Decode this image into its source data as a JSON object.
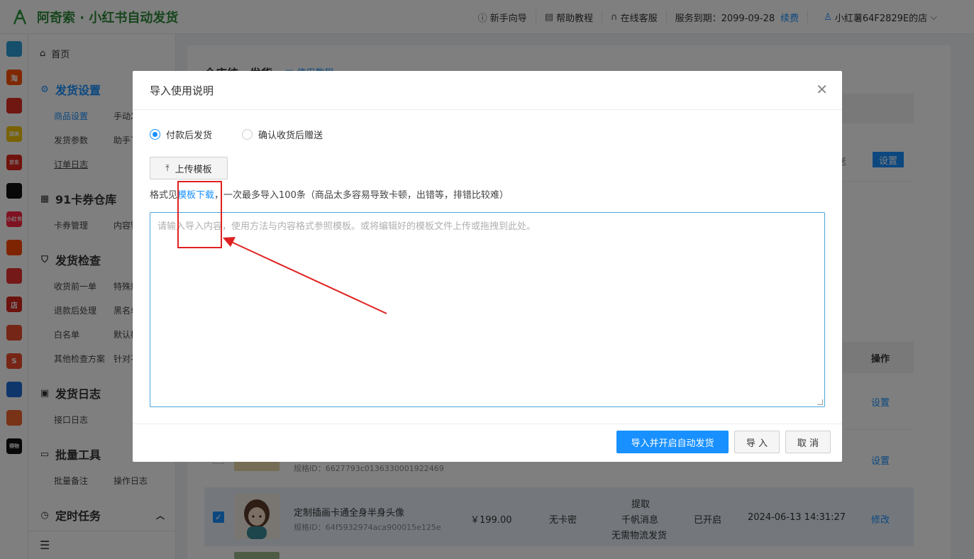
{
  "header": {
    "app_title": "阿奇索 · 小红书自动发货",
    "guide": "新手向导",
    "help": "帮助教程",
    "service": "在线客服",
    "expire": "服务到期：2099-09-28",
    "renew": "续费",
    "user": "小红薯64F2829E的店"
  },
  "strip": [
    {
      "icon": "grid-icon",
      "color": "#2a9fd6",
      "label": ""
    },
    {
      "icon": "taobao-icon",
      "color": "#ff5000",
      "label": "淘"
    },
    {
      "icon": "pinduoduo-icon",
      "color": "#e02e24",
      "label": ""
    },
    {
      "icon": "guomei-icon",
      "color": "#f5c400",
      "label": "国美"
    },
    {
      "icon": "jd-icon",
      "color": "#e1251b",
      "label": "京东"
    },
    {
      "icon": "douyin-icon",
      "color": "#111111",
      "label": ""
    },
    {
      "icon": "xiaohongshu-icon",
      "color": "#ff2442",
      "label": "小红书"
    },
    {
      "icon": "kuaishou-icon",
      "color": "#ff4906",
      "label": ""
    },
    {
      "icon": "thumb-icon",
      "color": "#e8322e",
      "label": ""
    },
    {
      "icon": "shop-icon",
      "color": "#d9261c",
      "label": "店"
    },
    {
      "icon": "bag-icon",
      "color": "#ea4d2c",
      "label": ""
    },
    {
      "icon": "shopee-icon",
      "color": "#ee4d2d",
      "label": "S"
    },
    {
      "icon": "link-icon",
      "color": "#1c6cd6",
      "label": ""
    },
    {
      "icon": "gift-icon",
      "color": "#f0642a",
      "label": ""
    },
    {
      "icon": "dewu-icon",
      "color": "#111111",
      "label": "得物"
    }
  ],
  "sidebar": {
    "home": "首页",
    "ship_settings": "发货设置",
    "goods_settings": "商品设置",
    "manual_ship": "手动发",
    "ship_params": "发货参数",
    "assistant": "助手下",
    "order_log": "订单日志",
    "card_store": "91卡券仓库",
    "card_manage": "卡券管理",
    "content": "内容管",
    "ship_check": "发货检查",
    "before_receipt": "收货前一单",
    "special": "特殊规",
    "after_refund": "退款后处理",
    "blacklist": "黑名单",
    "whitelist": "白名单",
    "default_rule": "默认检",
    "other_check": "其他检查方案",
    "target": "针对不",
    "ship_log": "发货日志",
    "api_log": "接口日志",
    "batch_tools": "批量工具",
    "batch_note": "批量备注",
    "op_log": "操作日志",
    "timed_task": "定时任务"
  },
  "main": {
    "title": "全店统一发货",
    "help_link": "使用教程",
    "partial_text": "送",
    "setting_btn": "设置",
    "col_op": "操作",
    "rows": [
      {
        "name": "",
        "spec": "",
        "price": "",
        "card": "",
        "extra": [],
        "status": "",
        "time": "",
        "action": "设置",
        "checked": false
      },
      {
        "name": "",
        "spec": "规格ID：6627793c0136330001922469",
        "price": "",
        "card": "",
        "extra": [],
        "status": "",
        "time": "",
        "action": "设置",
        "checked": false
      },
      {
        "name": "定制插画卡通全身半身头像",
        "spec": "规格ID：64f5932974aca900015e125e",
        "price": "￥199.00",
        "card": "无卡密",
        "extra": [
          "提取",
          "千帆消息",
          "无需物流发货"
        ],
        "status": "已开启",
        "time": "2024-06-13 14:31:27",
        "action": "修改",
        "checked": true
      }
    ]
  },
  "modal": {
    "title": "导入使用说明",
    "radio_options": [
      "付款后发货",
      "确认收货后赠送"
    ],
    "selected_radio": 0,
    "upload_label": "上传模板",
    "format_prefix": "格式见",
    "template_link": "模板下载",
    "format_suffix": "，一次最多导入100条（商品太多容易导致卡顿，出错等，排错比较难）",
    "textarea_placeholder": "请输入导入内容，使用方法与内容格式参照模板。或将编辑好的模板文件上传或拖拽到此处。",
    "btn_import_start": "导入并开启自动发货",
    "btn_import": "导 入",
    "btn_cancel": "取 消"
  },
  "colors": {
    "accent": "#1890ff",
    "brand_green": "#2f8a3a",
    "annotation_red": "#e02020"
  }
}
